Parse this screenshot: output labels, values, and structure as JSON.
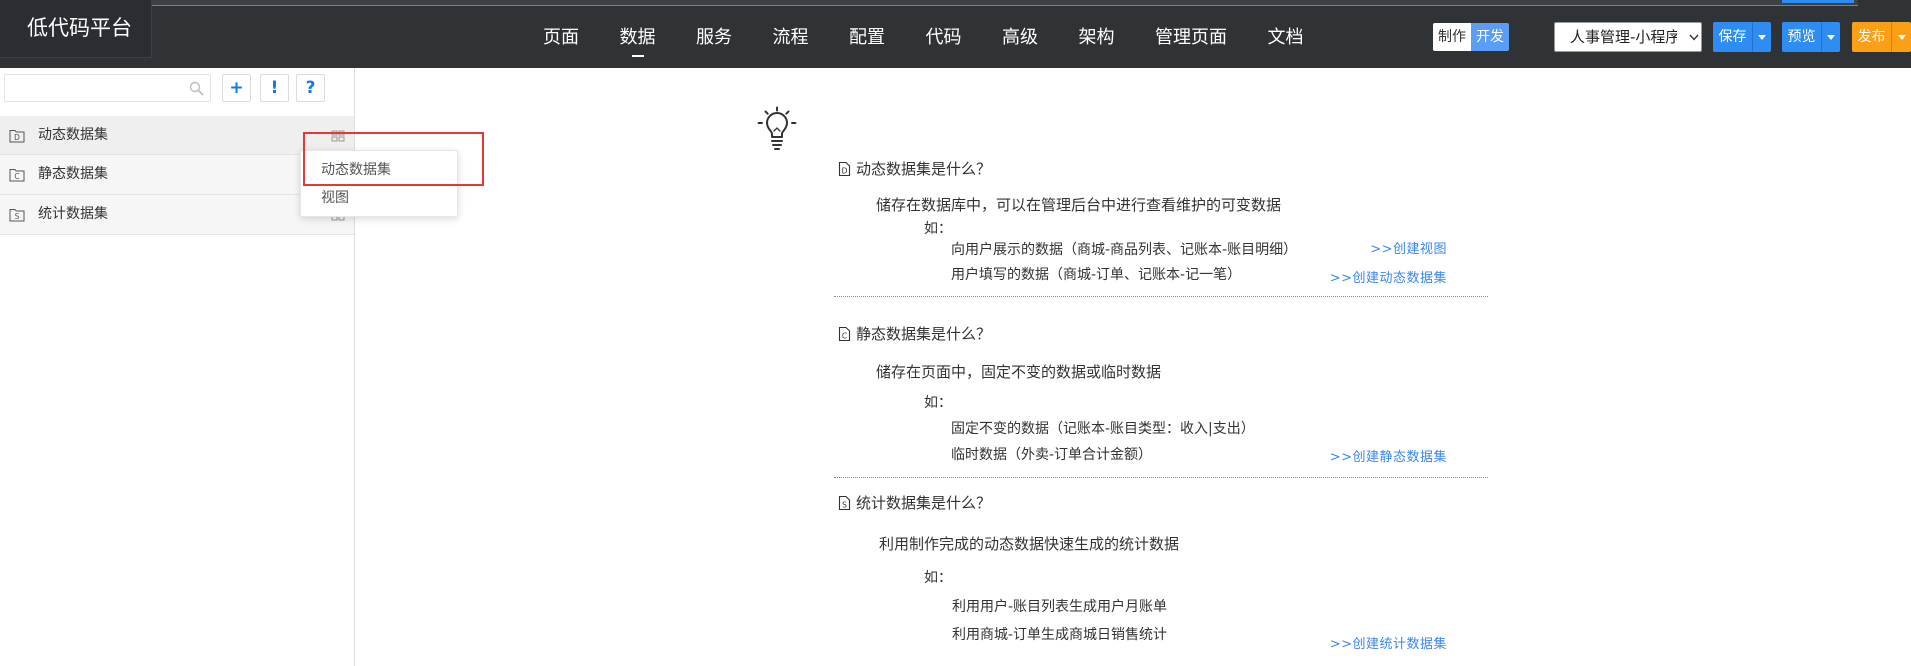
{
  "app": {
    "logo": "低代码平台"
  },
  "nav": {
    "items": [
      "页面",
      "数据",
      "服务",
      "流程",
      "配置",
      "代码",
      "高级",
      "架构",
      "管理页面",
      "文档"
    ]
  },
  "mode_toggle": {
    "options": [
      "制作",
      "开发"
    ]
  },
  "project_select": {
    "value": "人事管理-小程序"
  },
  "actions": {
    "save": "保存",
    "preview": "预览",
    "publish": "发布"
  },
  "sidebar": {
    "tools": {
      "add": "+",
      "info": "!",
      "help": "?"
    },
    "items": [
      {
        "label": "动态数据集",
        "icon": "dataset-folder-icon",
        "icon_letter": "D"
      },
      {
        "label": "静态数据集",
        "icon": "dataset-folder-icon",
        "icon_letter": "C"
      },
      {
        "label": "统计数据集",
        "icon": "dataset-folder-icon",
        "icon_letter": "S"
      }
    ]
  },
  "context_menu": {
    "items": [
      "动态数据集",
      "视图"
    ]
  },
  "main": {
    "icon": "lightbulb-icon",
    "sections": [
      {
        "icon": "document-letter-icon",
        "icon_letter": "D",
        "title": "动态数据集是什么？",
        "description": "储存在数据库中，可以在管理后台中进行查看维护的可变数据",
        "example_label": "如：",
        "examples": [
          "向用户展示的数据（商城-商品列表、记账本-账目明细）",
          "用户填写的数据（商城-订单、记账本-记一笔）"
        ],
        "links": [
          ">>创建视图",
          ">>创建动态数据集"
        ]
      },
      {
        "icon": "document-letter-icon",
        "icon_letter": "C",
        "title": "静态数据集是什么？",
        "description": "储存在页面中，固定不变的数据或临时数据",
        "example_label": "如：",
        "examples": [
          "固定不变的数据（记账本-账目类型：收入|支出）",
          "临时数据（外卖-订单合计金额）"
        ],
        "links": [
          ">>创建静态数据集"
        ]
      },
      {
        "icon": "document-letter-icon",
        "icon_letter": "S",
        "title": "统计数据集是什么？",
        "description": "利用制作完成的动态数据快速生成的统计数据",
        "example_label": "如：",
        "examples": [
          "利用用户-账目列表生成用户月账单",
          "利用商城-订单生成商城日销售统计"
        ],
        "links": [
          ">>创建统计数据集"
        ]
      }
    ]
  },
  "colors": {
    "nav_bg": "#303336",
    "logo_bg": "#2a2e32",
    "primary": "#2e8cf5",
    "toggle_active": "#5b9df6",
    "publish": "#fa9f16",
    "link": "#3a87f0",
    "highlight": "#e53935"
  }
}
